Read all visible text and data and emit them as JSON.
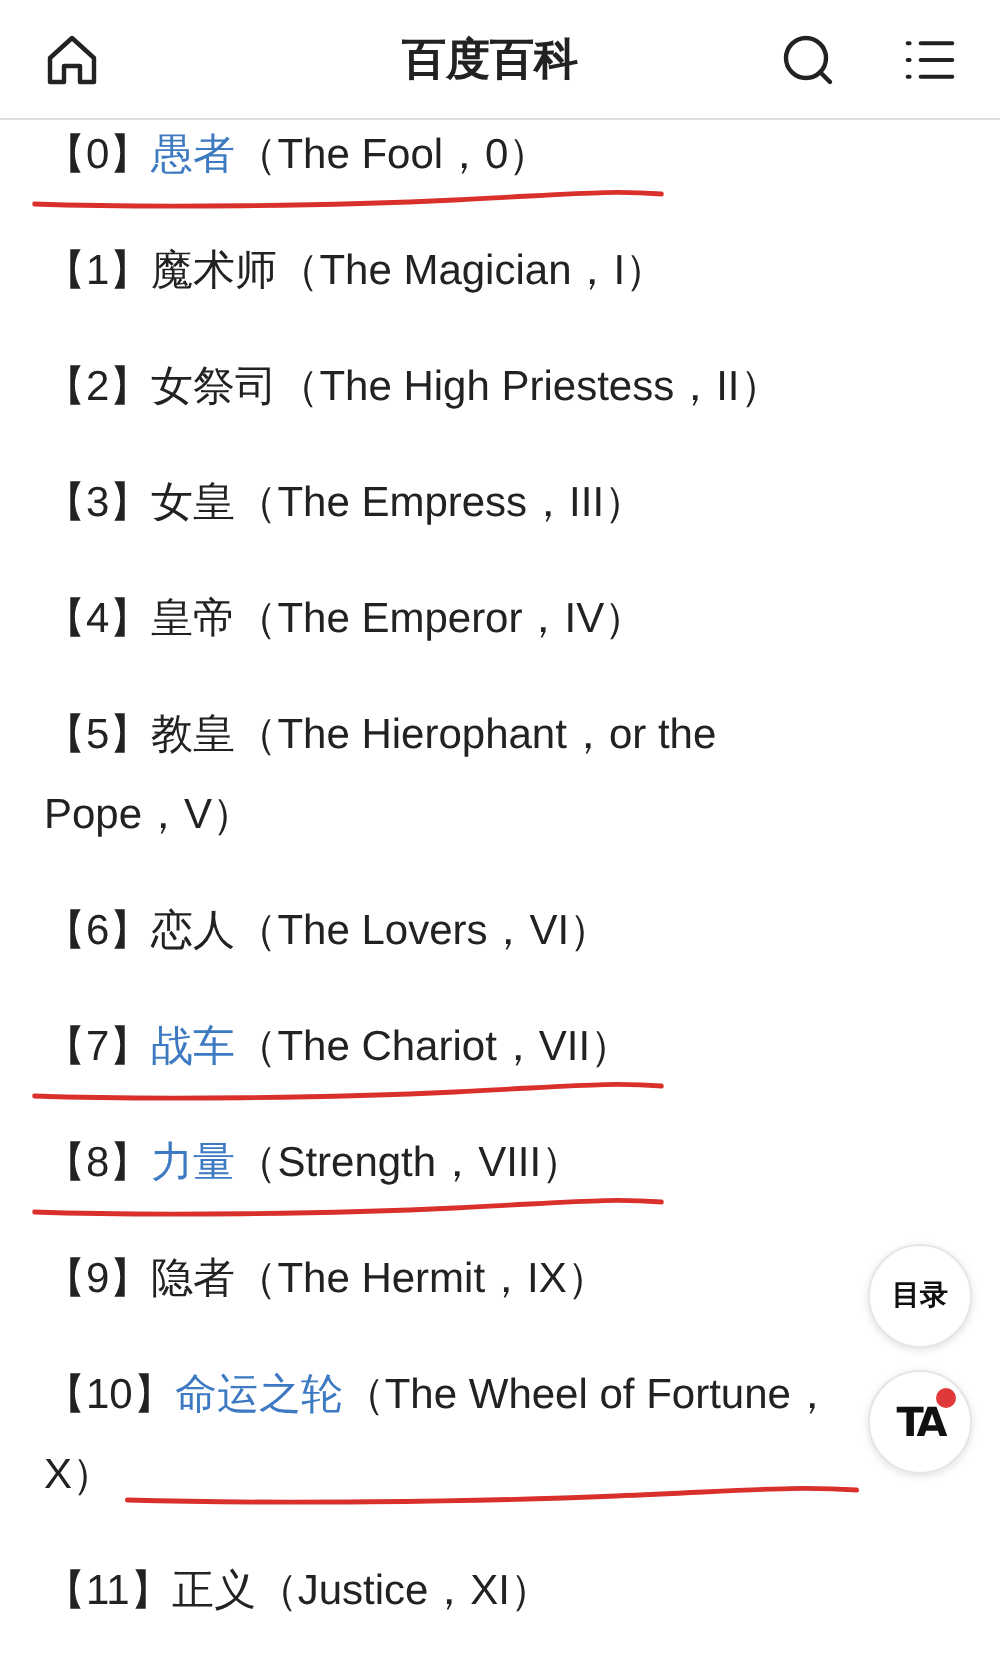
{
  "header": {
    "title": "百度百科"
  },
  "items": [
    {
      "number": "【0】",
      "name": "愚者",
      "linked": true,
      "detail": "（The Fool，0）",
      "underlined": true
    },
    {
      "number": "【1】",
      "name": "魔术师",
      "linked": false,
      "detail": "（The Magician，I）",
      "underlined": false
    },
    {
      "number": "【2】",
      "name": "女祭司",
      "linked": false,
      "detail": "（The High Priestess，II）",
      "underlined": false
    },
    {
      "number": "【3】",
      "name": "女皇",
      "linked": false,
      "detail": "（The Empress，III）",
      "underlined": false
    },
    {
      "number": "【4】",
      "name": "皇帝",
      "linked": false,
      "detail": "（The Emperor，IV）",
      "underlined": false
    },
    {
      "number": "【5】",
      "name": "教皇",
      "linked": false,
      "detail": "（The Hierophant，or the Pope，V）",
      "underlined": false
    },
    {
      "number": "【6】",
      "name": "恋人",
      "linked": false,
      "detail": "（The Lovers，VI）",
      "underlined": false
    },
    {
      "number": "【7】",
      "name": "战车",
      "linked": true,
      "detail": "（The Chariot，VII）",
      "underlined": true
    },
    {
      "number": "【8】",
      "name": "力量",
      "linked": true,
      "detail": "（Strength，VIII）",
      "underlined": true
    },
    {
      "number": "【9】",
      "name": "隐者",
      "linked": false,
      "detail": "（The Hermit，IX）",
      "underlined": false
    },
    {
      "number": "【10】",
      "name": "命运之轮",
      "linked": true,
      "detail": "（The Wheel of Fortune，X）",
      "underlined": true
    },
    {
      "number": "【11】",
      "name": "正义",
      "linked": false,
      "detail": "（Justice，XI）",
      "underlined": false
    }
  ],
  "floating": {
    "contents_label": "目录",
    "ta_label": "TA",
    "ta_notification": true
  }
}
